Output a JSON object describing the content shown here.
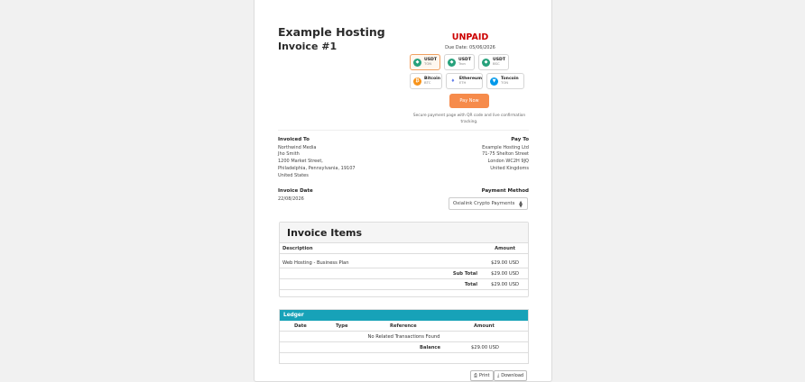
{
  "company": "Example Hosting",
  "invoice_number": "Invoice #1",
  "status": "UNPAID",
  "due_date": "Due Date: 05/06/2026",
  "coins": [
    {
      "name": "USDT",
      "network": "TON",
      "icon": "tether-icon",
      "color": "#26a17b"
    },
    {
      "name": "USDT",
      "network": "Tron",
      "icon": "tether-icon",
      "color": "#26a17b"
    },
    {
      "name": "USDT",
      "network": "BSC",
      "icon": "tether-icon",
      "color": "#26a17b"
    },
    {
      "name": "Bitcoin",
      "network": "BTC",
      "icon": "bitcoin-icon",
      "color": "#f7931a"
    },
    {
      "name": "Ethereum",
      "network": "ETH",
      "icon": "ethereum-icon",
      "color": "#627eea"
    },
    {
      "name": "Toncoin",
      "network": "TON",
      "icon": "toncoin-icon",
      "color": "#0098ea"
    }
  ],
  "pay_now": "Pay Now",
  "secure_note": "Secure payment page with QR code and live confirmation tracking.",
  "invoiced_to": {
    "heading": "Invoiced To",
    "lines": [
      "Northwind Media",
      "Jho Smith",
      "1200 Market Street,",
      "Philadelphia, Pennsylvania, 19107",
      "United States"
    ]
  },
  "pay_to": {
    "heading": "Pay To",
    "lines": [
      "Example Hosting Ltd",
      "71-75 Shelton Street",
      "London WC2H 9JQ",
      "United Kingdoms"
    ]
  },
  "invoice_date": {
    "heading": "Invoice Date",
    "value": "22/08/2026"
  },
  "payment_method": {
    "heading": "Payment Method",
    "selected": "Oxialink Crypto Payments"
  },
  "items": {
    "title": "Invoice Items",
    "col_description": "Description",
    "col_amount": "Amount",
    "rows": [
      {
        "description": "Web Hosting - Business Plan",
        "amount": "$29.00 USD"
      }
    ],
    "subtotal_label": "Sub Total",
    "subtotal": "$29.00 USD",
    "total_label": "Total",
    "total": "$29.00 USD"
  },
  "ledger": {
    "title": "Ledger",
    "cols": [
      "Date",
      "Type",
      "Reference",
      "Amount"
    ],
    "empty": "No Related Transactions Found",
    "balance_label": "Balance",
    "balance": "$29.00 USD"
  },
  "actions": {
    "print": "Print",
    "download": "Download"
  }
}
